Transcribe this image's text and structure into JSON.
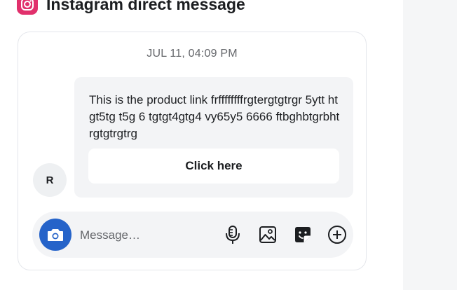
{
  "header": {
    "title": "Instagram direct message",
    "icon": "instagram-icon"
  },
  "conversation": {
    "timestamp": "JUL 11, 04:09 PM",
    "avatar_initial": "R",
    "message": {
      "text": "This is the product link frffffffffrgtergtgtrgr 5ytt htgt5tg t5g 6 tgtgt4gtg4 vy65y5 6666 ftbghbtgrbhtrgtgtrgtrg",
      "button_label": "Click here"
    }
  },
  "composer": {
    "placeholder": "Message…",
    "icons": [
      "camera-icon",
      "microphone-icon",
      "image-icon",
      "sticker-icon",
      "add-icon"
    ]
  },
  "colors": {
    "camera_button": "#2563c9",
    "instagram": "#e1306c",
    "bubble": "#f3f4f6"
  }
}
